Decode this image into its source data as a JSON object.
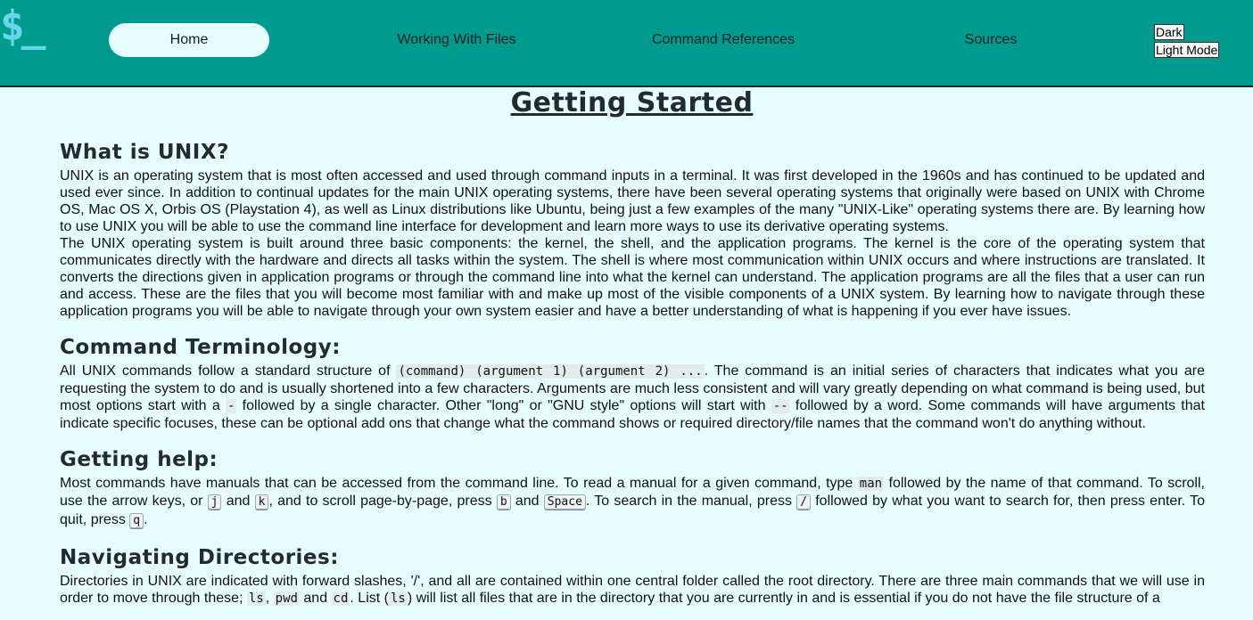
{
  "logo": "$_",
  "nav": {
    "home": "Home",
    "files": "Working With Files",
    "commands": "Command References",
    "sources": "Sources"
  },
  "mode": {
    "dark": "Dark",
    "light": "Light Mode"
  },
  "page_title": "Getting Started",
  "sections": {
    "unix": {
      "heading": "What is UNIX?",
      "p1": "UNIX is an operating system that is most often accessed and used through command inputs in a terminal. It was first developed in the 1960s and has continued to be updated and used ever since. In addition to continual updates for the main UNIX operating systems, there have been several operating systems that originally were based on UNIX with Chrome OS, Mac OS X, Orbis OS (Playstation 4), as well as Linux distributions like Ubuntu, being just a few examples of the many \"UNIX-Like\" operating systems there are. By learning how to use UNIX you will be able to use the command line interface for development and learn more ways to use its derivative operating systems.",
      "p2": "The UNIX operating system is built around three basic components: the kernel, the shell, and the application programs. The kernel is the core of the operating system that communicates directly with the hardware and directs all tasks within the system. The shell is where most communication within UNIX occurs and where instructions are translated. It converts the directions given in application programs or through the command line into what the kernel can understand. The application programs are all the files that a user can run and access. These are the files that you will become most familiar with and make up most of the visible components of a UNIX system. By learning how to navigate through these application programs you will be able to navigate through your own system easier and have a better understanding of what is happening if you ever have issues."
    },
    "terminology": {
      "heading": "Command Terminology:",
      "t1": "All UNIX commands follow a standard structure of ",
      "code1": "(command) (argument 1) (argument 2) ...",
      "t2": ". The command is an initial series of characters that indicates what you are requesting the system to do and is usually shortened into a few characters. Arguments are much less consistent and will vary greatly depending on what command is being used, but most options start with a ",
      "code2": "-",
      "t3": " followed by a single character. Other \"long\" or \"GNU style\" options will start with ",
      "code3": "--",
      "t4": " followed by a word. Some commands will have arguments that indicate specific focuses, these can be optional add ons that change what the command shows or required directory/file names that the command won't do anything without."
    },
    "help": {
      "heading": "Getting help:",
      "t1": "Most commands have manuals that can be accessed from the command line. To read a manual for a given command, type ",
      "code1": "man",
      "t2": " followed by the name of that command. To scroll, use the arrow keys, or ",
      "k1": "j",
      "t3": " and ",
      "k2": "k",
      "t4": ", and to scroll page-by-page, press ",
      "k3": "b",
      "t5": " and ",
      "k4": "Space",
      "t6": ". To search in the manual, press ",
      "k5": "/",
      "t7": " followed by what you want to search for, then press enter. To quit, press ",
      "k6": "q",
      "t8": "."
    },
    "navigating": {
      "heading": "Navigating Directories:",
      "t1": "Directories in UNIX are indicated with forward slashes, '/', and all are contained within one central folder called the root directory. There are three main commands that we will use in order to move through these; ",
      "c1": "ls",
      "t2": ", ",
      "c2": "pwd",
      "t3": " and ",
      "c3": "cd",
      "t4": ". List (",
      "c4": "ls",
      "t5": ") will list all files that are in the directory that you are currently in and is essential if you do not have the file structure of a"
    }
  }
}
